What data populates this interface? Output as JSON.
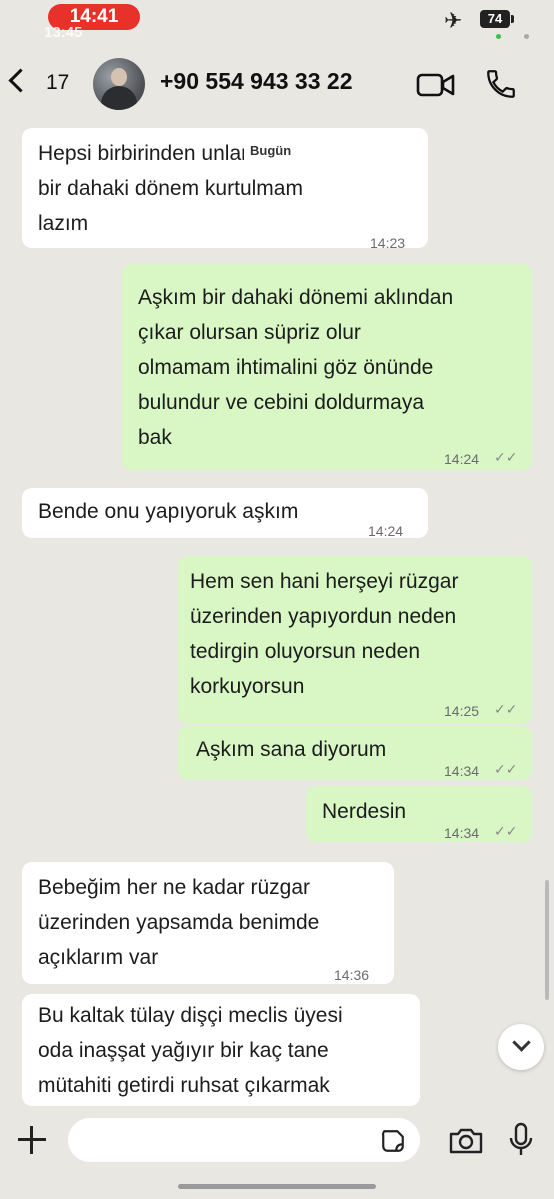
{
  "status_bar": {
    "time": "14:41",
    "ghost_time": "13:45",
    "battery": "74"
  },
  "header": {
    "back_count": "17",
    "contact": "+90 554 943 33 22"
  },
  "date_separator": "Bugün",
  "messages": [
    {
      "direction": "in",
      "text": "Hepsi birbirinden        unlardan\nbir dahaki dönem kurtulmam\nlazım",
      "time": "14:23"
    },
    {
      "direction": "out",
      "text": "Aşkım bir dahaki dönemi aklından\nçıkar olursan süpriz olur\nolmamam ihtimalini göz önünde\nbulundur ve cebini doldurmaya\nbak",
      "time": "14:24",
      "status": "read"
    },
    {
      "direction": "in",
      "text": "Bende onu yapıyoruk aşkım",
      "time": "14:24"
    },
    {
      "direction": "out",
      "text": "Hem sen hani herşeyi rüzgar\nüzerinden yapıyordun neden\ntedirgin oluyorsun neden\nkorkuyorsun",
      "time": "14:25",
      "status": "read"
    },
    {
      "direction": "out",
      "text": "Aşkım sana diyorum",
      "time": "14:34",
      "status": "read"
    },
    {
      "direction": "out",
      "text": "Nerdesin",
      "time": "14:34",
      "status": "read"
    },
    {
      "direction": "in",
      "text": "Bebeğim her ne kadar rüzgar\nüzerinden yapsamda benimde\naçıklarım var",
      "time": "14:36"
    },
    {
      "direction": "in",
      "text": "Bu kaltak tülay dişçi meclis üyesi\noda inaşşat yağıyır bir kaç tane\nmütahiti getirdi ruhsat çıkarmak",
      "time": ""
    }
  ],
  "input": {
    "placeholder": ""
  },
  "icons": [
    "back-chevron-icon",
    "avatar",
    "video-call-icon",
    "phone-call-icon",
    "plus-icon",
    "sticker-icon",
    "camera-icon",
    "microphone-icon",
    "scroll-down-icon",
    "airplane-icon",
    "battery-icon"
  ],
  "colors": {
    "outgoing_bubble": "#d8f7c5",
    "incoming_bubble": "#ffffff",
    "background": "#e9e7e2",
    "time_pill": "#e8312a"
  }
}
